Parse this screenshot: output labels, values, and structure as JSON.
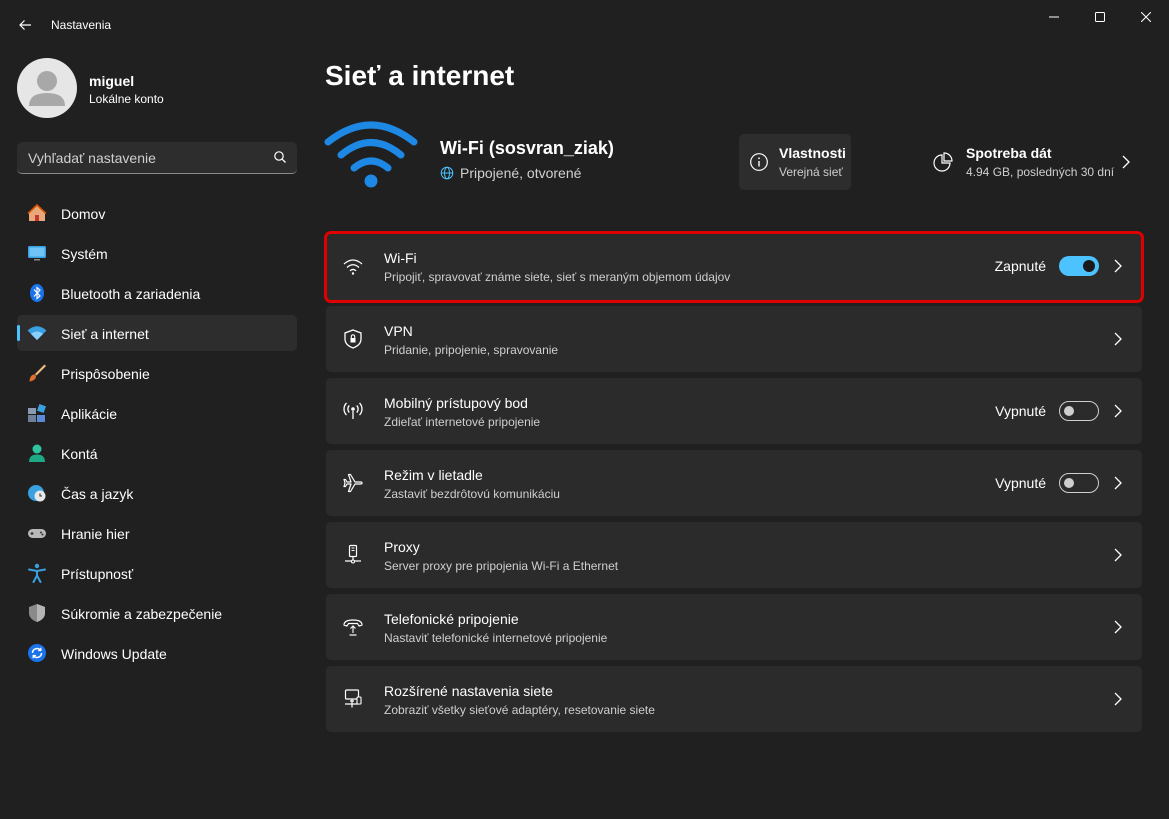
{
  "window": {
    "title": "Nastavenia"
  },
  "profile": {
    "name": "miguel",
    "account_type": "Lokálne konto"
  },
  "search": {
    "placeholder": "Vyhľadať nastavenie"
  },
  "sidebar": {
    "items": [
      {
        "label": "Domov",
        "icon": "home-icon"
      },
      {
        "label": "Systém",
        "icon": "monitor-icon"
      },
      {
        "label": "Bluetooth a zariadenia",
        "icon": "bluetooth-icon"
      },
      {
        "label": "Sieť a internet",
        "icon": "wifi-icon",
        "active": true
      },
      {
        "label": "Prispôsobenie",
        "icon": "brush-icon"
      },
      {
        "label": "Aplikácie",
        "icon": "apps-icon"
      },
      {
        "label": "Kontá",
        "icon": "person-icon"
      },
      {
        "label": "Čas a jazyk",
        "icon": "globe-clock-icon"
      },
      {
        "label": "Hranie hier",
        "icon": "gamepad-icon"
      },
      {
        "label": "Prístupnosť",
        "icon": "accessibility-icon"
      },
      {
        "label": "Súkromie a zabezpečenie",
        "icon": "shield-icon"
      },
      {
        "label": "Windows Update",
        "icon": "update-icon"
      }
    ]
  },
  "main": {
    "title": "Sieť a internet",
    "connection": {
      "name": "Wi-Fi (sosvran_ziak)",
      "status": "Pripojené, otvorené"
    },
    "properties": {
      "title": "Vlastnosti",
      "subtitle": "Verejná sieť"
    },
    "data_usage": {
      "title": "Spotreba dát",
      "subtitle": "4.94 GB, posledných 30 dní"
    },
    "cards": [
      {
        "title": "Wi-Fi",
        "subtitle": "Pripojiť, spravovať známe siete, sieť s meraným objemom údajov",
        "state": "Zapnuté",
        "toggle": "on",
        "icon": "wifi-icon"
      },
      {
        "title": "VPN",
        "subtitle": "Pridanie, pripojenie, spravovanie",
        "icon": "vpn-shield-icon"
      },
      {
        "title": "Mobilný prístupový bod",
        "subtitle": "Zdieľať internetové pripojenie",
        "state": "Vypnuté",
        "toggle": "off",
        "icon": "hotspot-icon"
      },
      {
        "title": "Režim v lietadle",
        "subtitle": "Zastaviť bezdrôtovú komunikáciu",
        "state": "Vypnuté",
        "toggle": "off",
        "icon": "airplane-icon"
      },
      {
        "title": "Proxy",
        "subtitle": "Server proxy pre pripojenia Wi-Fi a Ethernet",
        "icon": "proxy-icon"
      },
      {
        "title": "Telefonické pripojenie",
        "subtitle": "Nastaviť telefonické internetové pripojenie",
        "icon": "dialup-icon"
      },
      {
        "title": "Rozšírené nastavenia siete",
        "subtitle": "Zobraziť všetky sieťové adaptéry, resetovanie siete",
        "icon": "network-pc-icon"
      }
    ]
  },
  "colors": {
    "accent": "#4cc2ff",
    "background": "#202020",
    "card": "#2b2b2b",
    "highlight": "#e00000"
  }
}
